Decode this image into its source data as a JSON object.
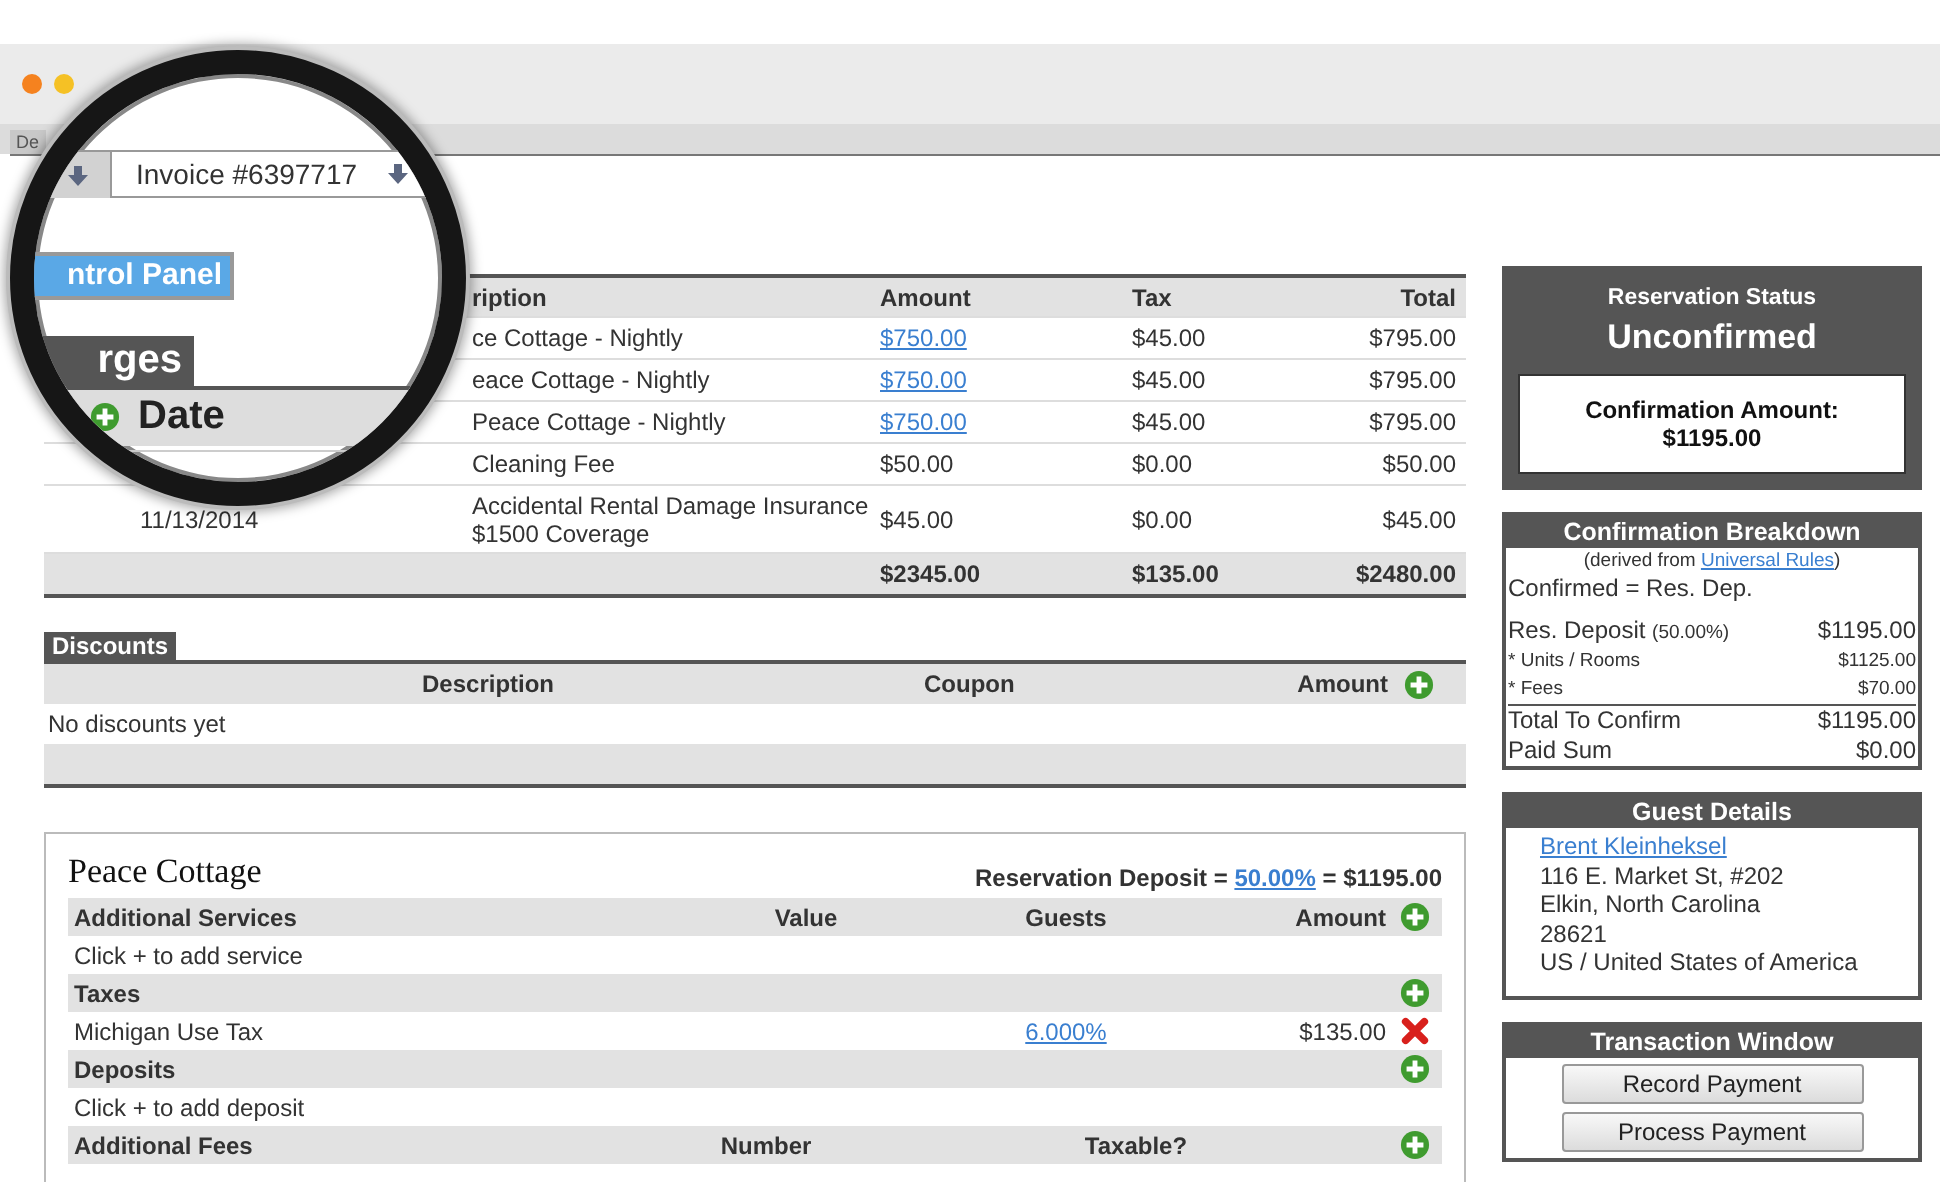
{
  "browser": {
    "tab": "De"
  },
  "tabs": [
    {
      "selected": false
    },
    {
      "label": "Invoice #6397717",
      "selected": true
    }
  ],
  "control_panel_button": "ntrol Panel",
  "charges": {
    "title": "rges",
    "columns": {
      "date": "Date",
      "description": "ription",
      "amount": "Amount",
      "tax": "Tax",
      "total": "Total"
    },
    "rows": [
      {
        "description": "ce Cottage - Nightly",
        "amount": "$750.00",
        "amount_is_link": true,
        "tax": "$45.00",
        "total": "$795.00"
      },
      {
        "description": "eace Cottage - Nightly",
        "amount": "$750.00",
        "amount_is_link": true,
        "tax": "$45.00",
        "total": "$795.00"
      },
      {
        "description": "Peace Cottage - Nightly",
        "amount": "$750.00",
        "amount_is_link": true,
        "tax": "$45.00",
        "total": "$795.00"
      },
      {
        "description": "Cleaning Fee",
        "amount": "$50.00",
        "amount_is_link": false,
        "tax": "$0.00",
        "total": "$50.00"
      },
      {
        "date": "11/13/2014",
        "description": "Accidental Rental Damage Insurance\n$1500 Coverage",
        "amount": "$45.00",
        "amount_is_link": false,
        "tax": "$0.00",
        "total": "$45.00"
      }
    ],
    "totals": {
      "amount": "$2345.00",
      "tax": "$135.00",
      "total": "$2480.00"
    }
  },
  "discounts": {
    "title": "Discounts",
    "columns": [
      "Description",
      "Coupon",
      "Amount"
    ],
    "empty": "No discounts yet"
  },
  "unit": {
    "name": "Peace Cottage",
    "deposit": {
      "label": "Reservation Deposit =",
      "percent": "50.00%",
      "equals": "=",
      "amount": "$1195.00"
    },
    "sections": [
      {
        "kind": "services",
        "title": "Additional Services",
        "columns": [
          "Value",
          "Guests",
          "Amount"
        ],
        "empty": "Click + to add service"
      },
      {
        "kind": "taxes",
        "title": "Taxes",
        "items": [
          {
            "name": "Michigan Use Tax",
            "rate": "6.000%",
            "amount": "$135.00"
          }
        ]
      },
      {
        "kind": "deposits",
        "title": "Deposits",
        "empty": "Click + to add deposit"
      },
      {
        "kind": "fees",
        "title": "Additional Fees",
        "columns": [
          "Number",
          "Taxable?"
        ]
      }
    ]
  },
  "reservation_status": {
    "title": "Reservation Status",
    "status": "Unconfirmed",
    "amount_label": "Confirmation Amount:",
    "amount": "$1195.00"
  },
  "confirmation_breakdown": {
    "title": "Confirmation Breakdown",
    "derived_prefix": "(derived from",
    "derived_link": "Universal Rules",
    "derived_suffix": ")",
    "rule": "Confirmed = Res. Dep.",
    "rows": [
      {
        "kind": "main",
        "label": "Res. Deposit",
        "note": "(50.00%)",
        "value": "$1195.00"
      },
      {
        "kind": "sub",
        "label": "* Units / Rooms",
        "value": "$1125.00"
      },
      {
        "kind": "sub",
        "label": "* Fees",
        "value": "$70.00"
      },
      {
        "kind": "total",
        "label": "Total To Confirm",
        "value": "$1195.00"
      },
      {
        "kind": "main",
        "label": "Paid Sum",
        "value": "$0.00"
      }
    ]
  },
  "guest_details": {
    "title": "Guest Details",
    "name": "Brent Kleinheksel",
    "address": [
      "116 E. Market St, #202",
      "Elkin, North Carolina",
      "28621",
      "US / United States of America"
    ]
  },
  "transaction_window": {
    "title": "Transaction Window",
    "buttons": [
      "Record Payment",
      "Process Payment"
    ]
  }
}
